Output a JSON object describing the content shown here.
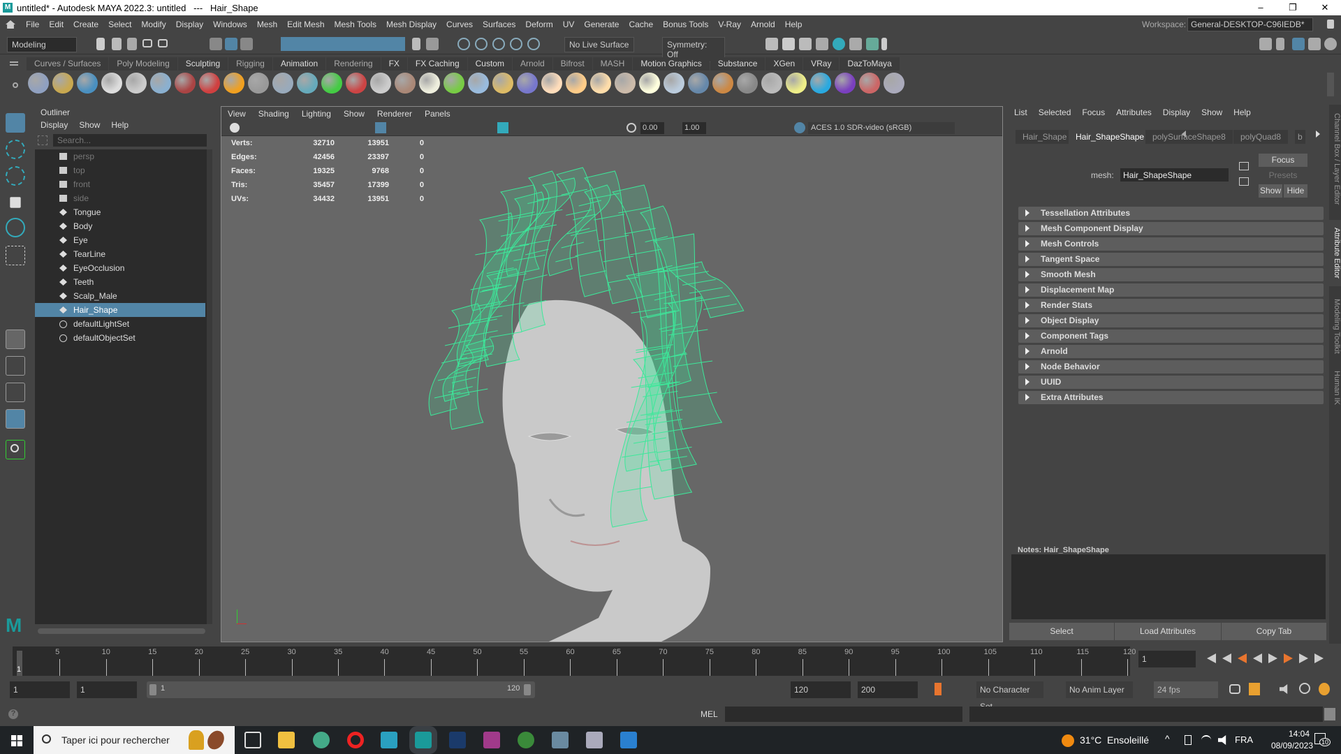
{
  "title": "untitled* - Autodesk MAYA 2022.3: untitled   ---   Hair_Shape",
  "window_controls": [
    "–",
    "❐",
    "✕"
  ],
  "menu": [
    "File",
    "Edit",
    "Create",
    "Select",
    "Modify",
    "Display",
    "Windows",
    "Mesh",
    "Edit Mesh",
    "Mesh Tools",
    "Mesh Display",
    "Curves",
    "Surfaces",
    "Deform",
    "UV",
    "Generate",
    "Cache",
    "Bonus Tools",
    "V-Ray",
    "Arnold",
    "Help"
  ],
  "workspace": {
    "label": "Workspace:",
    "value": "General-DESKTOP-C96IEDB*"
  },
  "status": {
    "mode": "Modeling",
    "live_surface": "No Live Surface",
    "symmetry": "Symmetry: Off"
  },
  "shelf_tabs": [
    "Curves / Surfaces",
    "Poly Modeling",
    "Sculpting",
    "Rigging",
    "Animation",
    "Rendering",
    "FX",
    "FX Caching",
    "Custom",
    "Arnold",
    "Bifrost",
    "MASH",
    "Motion Graphics",
    "Substance",
    "XGen",
    "VRay",
    "DazToMaya"
  ],
  "shelf_icons": [
    {
      "name": "vray-settings-icon",
      "color": "#8fa0c0"
    },
    {
      "name": "vray-render-icon",
      "color": "#c8a850"
    },
    {
      "name": "vray-framebuffer-icon",
      "color": "#4a90c0"
    },
    {
      "name": "vray-plugin-icon",
      "color": "#ddd"
    },
    {
      "name": "vray-scene-icon",
      "color": "#ccc"
    },
    {
      "name": "vray-material-icon",
      "color": "#8ab0d0"
    },
    {
      "name": "vray-camera-icon",
      "color": "#aa4444"
    },
    {
      "name": "vray-spheres-icon",
      "color": "#d04040"
    },
    {
      "name": "vray-fire-icon",
      "color": "#f0a020"
    },
    {
      "name": "vray-proxy-icon",
      "color": "#999"
    },
    {
      "name": "vray-cube-icon",
      "color": "#9ab"
    },
    {
      "name": "vray-cone-icon",
      "color": "#6ab"
    },
    {
      "name": "vray-volume-icon",
      "color": "#4c4"
    },
    {
      "name": "vray-fur-icon",
      "color": "#c44"
    },
    {
      "name": "vray-dome-icon",
      "color": "#ccc"
    },
    {
      "name": "vray-texture-icon",
      "color": "#a87"
    },
    {
      "name": "vray-sphere-light-icon",
      "color": "#eed"
    },
    {
      "name": "vray-grass-icon",
      "color": "#7c4"
    },
    {
      "name": "vray-scatter-icon",
      "color": "#9bd"
    },
    {
      "name": "vray-link-icon",
      "color": "#db6"
    },
    {
      "name": "vray-globe-icon",
      "color": "#77c"
    },
    {
      "name": "vray-dome-light-icon",
      "color": "#fdb"
    },
    {
      "name": "vray-spot-light-icon",
      "color": "#fc8"
    },
    {
      "name": "vray-omni-light-icon",
      "color": "#fda"
    },
    {
      "name": "vray-ies-light-icon",
      "color": "#cba"
    },
    {
      "name": "vray-sun-icon",
      "color": "#ffd"
    },
    {
      "name": "vray-plane-icon",
      "color": "#bcd"
    },
    {
      "name": "vray-blue-sphere-icon",
      "color": "#68a"
    },
    {
      "name": "vray-material-ball-icon",
      "color": "#c84"
    },
    {
      "name": "vray-checker-icon",
      "color": "#888"
    },
    {
      "name": "vray-vfb-icon",
      "color": "#bbb"
    },
    {
      "name": "vray-light-lister-icon",
      "color": "#ee8"
    },
    {
      "name": "daz-bridge-icon",
      "color": "#29a9e0"
    },
    {
      "name": "daz-figure-icon",
      "color": "#7a3fbf"
    },
    {
      "name": "daz-morph-icon",
      "color": "#c66"
    },
    {
      "name": "help-icon",
      "color": "#aab"
    }
  ],
  "outliner": {
    "title": "Outliner",
    "menu": [
      "Display",
      "Show",
      "Help"
    ],
    "search_placeholder": "Search...",
    "items": [
      {
        "label": "persp",
        "type": "camera",
        "dim": true
      },
      {
        "label": "top",
        "type": "camera",
        "dim": true
      },
      {
        "label": "front",
        "type": "camera",
        "dim": true
      },
      {
        "label": "side",
        "type": "camera",
        "dim": true
      },
      {
        "label": "Tongue",
        "type": "mesh"
      },
      {
        "label": "Body",
        "type": "mesh"
      },
      {
        "label": "Eye",
        "type": "mesh"
      },
      {
        "label": "TearLine",
        "type": "mesh"
      },
      {
        "label": "EyeOcclusion",
        "type": "mesh"
      },
      {
        "label": "Teeth",
        "type": "mesh"
      },
      {
        "label": "Scalp_Male",
        "type": "mesh"
      },
      {
        "label": "Hair_Shape",
        "type": "mesh",
        "selected": true
      },
      {
        "label": "defaultLightSet",
        "type": "set"
      },
      {
        "label": "defaultObjectSet",
        "type": "set"
      }
    ]
  },
  "viewport": {
    "menu": [
      "View",
      "Shading",
      "Lighting",
      "Show",
      "Renderer",
      "Panels"
    ],
    "exposure": "0.00",
    "gamma": "1.00",
    "color_space": "ACES 1.0 SDR-video (sRGB)",
    "stats": [
      [
        "Verts:",
        "32710",
        "13951",
        "0"
      ],
      [
        "Edges:",
        "42456",
        "23397",
        "0"
      ],
      [
        "Faces:",
        "19325",
        "9768",
        "0"
      ],
      [
        "Tris:",
        "35457",
        "17399",
        "0"
      ],
      [
        "UVs:",
        "34432",
        "13951",
        "0"
      ]
    ]
  },
  "attribute_editor": {
    "menu": [
      "List",
      "Selected",
      "Focus",
      "Attributes",
      "Display",
      "Show",
      "Help"
    ],
    "tabs": [
      "Hair_Shape",
      "Hair_ShapeShape",
      "polySurfaceShape8",
      "polyQuad8",
      "b"
    ],
    "mesh_label": "mesh:",
    "mesh_value": "Hair_ShapeShape",
    "focus": "Focus",
    "presets": "Presets",
    "show": "Show",
    "hide": "Hide",
    "sections": [
      "Tessellation Attributes",
      "Mesh Component Display",
      "Mesh Controls",
      "Tangent Space",
      "Smooth Mesh",
      "Displacement Map",
      "Render Stats",
      "Object Display",
      "Component Tags",
      "Arnold",
      "Node Behavior",
      "UUID",
      "Extra Attributes"
    ],
    "notes_label": "Notes:  Hair_ShapeShape",
    "buttons": [
      "Select",
      "Load Attributes",
      "Copy Tab"
    ]
  },
  "side_tabs": [
    "Channel Box / Layer Editor",
    "Attribute Editor",
    "Modeling Toolkit",
    "Human IK"
  ],
  "timeline": {
    "ticks": [
      5,
      10,
      15,
      20,
      25,
      30,
      35,
      40,
      45,
      50,
      55,
      60,
      65,
      70,
      75,
      80,
      85,
      90,
      95,
      100,
      105,
      110,
      115,
      120
    ],
    "current_frame": "1",
    "current_field": "1"
  },
  "range": {
    "start": "1",
    "anim_start": "1",
    "slider_start": "1",
    "slider_end": "120",
    "end": "120",
    "anim_end": "200",
    "character_set": "No Character Set",
    "anim_layer": "No Anim Layer",
    "fps": "24 fps"
  },
  "command": {
    "label": "MEL"
  },
  "taskbar": {
    "search_placeholder": "Taper ici pour rechercher",
    "weather": "31°C  Ensoleillé",
    "lang": "FRA",
    "time": "14:04",
    "date": "08/09/2023",
    "notifications": "10"
  },
  "colors": {
    "accent": "#5285a6",
    "wireframe": "#3de89a"
  }
}
